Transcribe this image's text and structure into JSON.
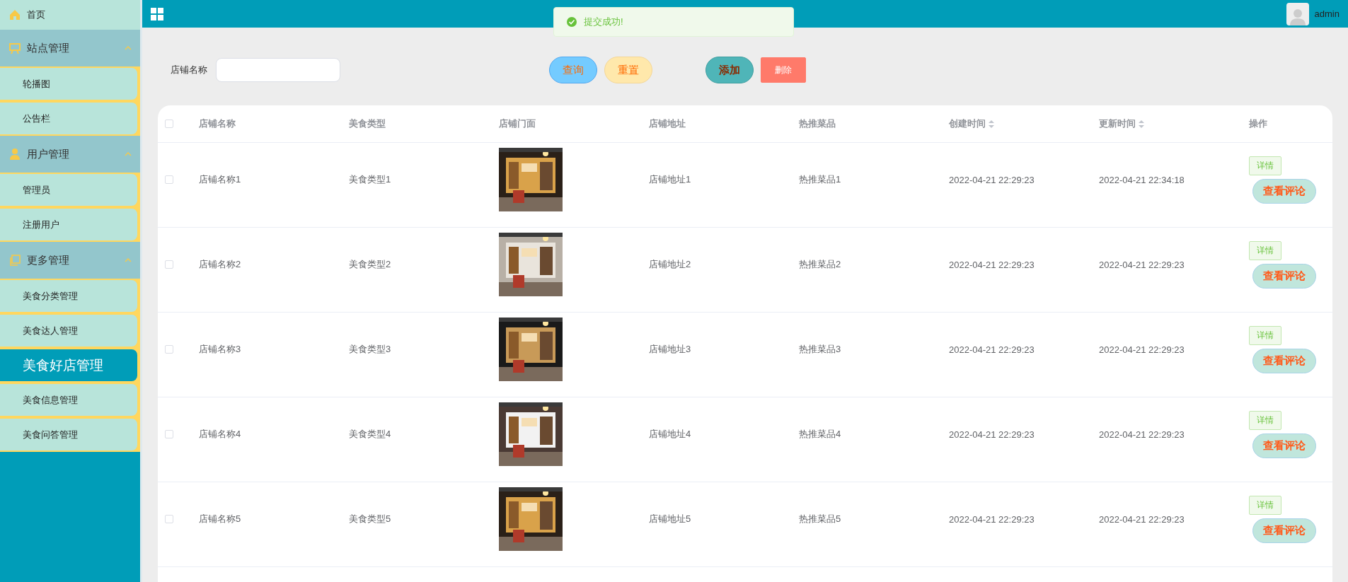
{
  "sidebar": {
    "items": [
      {
        "kind": "link",
        "label": "首页",
        "selected": false
      },
      {
        "kind": "group",
        "label": "站点管理",
        "expanded": true,
        "children": [
          {
            "label": "轮播图",
            "selected": false
          },
          {
            "label": "公告栏",
            "selected": false
          }
        ]
      },
      {
        "kind": "group",
        "label": "用户管理",
        "expanded": true,
        "children": [
          {
            "label": "管理员",
            "selected": false
          },
          {
            "label": "注册用户",
            "selected": false
          }
        ]
      },
      {
        "kind": "group",
        "label": "更多管理",
        "expanded": true,
        "children": [
          {
            "label": "美食分类管理",
            "selected": false
          },
          {
            "label": "美食达人管理",
            "selected": false
          },
          {
            "label": "美食好店管理",
            "selected": true
          },
          {
            "label": "美食信息管理",
            "selected": false
          },
          {
            "label": "美食问答管理",
            "selected": false
          }
        ]
      }
    ]
  },
  "header": {
    "user": "admin"
  },
  "toast": {
    "message": "提交成功!",
    "kind": "success"
  },
  "search": {
    "label": "店铺名称"
  },
  "buttons": [
    {
      "label": "查询",
      "kind": "query"
    },
    {
      "label": "重置",
      "kind": "reset"
    },
    {
      "label": "添加",
      "kind": "add"
    },
    {
      "label": "删除",
      "kind": "delete"
    }
  ],
  "table": {
    "all_checked": false,
    "columns": [
      {
        "label": "店铺名称",
        "sortable": false
      },
      {
        "label": "美食类型",
        "sortable": false
      },
      {
        "label": "店铺门面",
        "sortable": false
      },
      {
        "label": "店铺地址",
        "sortable": false
      },
      {
        "label": "热推菜品",
        "sortable": false
      },
      {
        "label": "创建时间",
        "sortable": true
      },
      {
        "label": "更新时间",
        "sortable": true
      },
      {
        "label": "操作",
        "sortable": false
      }
    ],
    "rows": [
      {
        "checked": false,
        "name": "店铺名称1",
        "type": "美食类型1",
        "address": "店铺地址1",
        "dish": "热推菜品1",
        "created": "2022-04-21 22:29:23",
        "updated": "2022-04-21 22:34:18",
        "detail": "详情",
        "comments": "查看评论"
      },
      {
        "checked": false,
        "name": "店铺名称2",
        "type": "美食类型2",
        "address": "店铺地址2",
        "dish": "热推菜品2",
        "created": "2022-04-21 22:29:23",
        "updated": "2022-04-21 22:29:23",
        "detail": "详情",
        "comments": "查看评论"
      },
      {
        "checked": false,
        "name": "店铺名称3",
        "type": "美食类型3",
        "address": "店铺地址3",
        "dish": "热推菜品3",
        "created": "2022-04-21 22:29:23",
        "updated": "2022-04-21 22:29:23",
        "detail": "详情",
        "comments": "查看评论"
      },
      {
        "checked": false,
        "name": "店铺名称4",
        "type": "美食类型4",
        "address": "店铺地址4",
        "dish": "热推菜品4",
        "created": "2022-04-21 22:29:23",
        "updated": "2022-04-21 22:29:23",
        "detail": "详情",
        "comments": "查看评论"
      },
      {
        "checked": false,
        "name": "店铺名称5",
        "type": "美食类型5",
        "address": "店铺地址5",
        "dish": "热推菜品5",
        "created": "2022-04-21 22:29:23",
        "updated": "2022-04-21 22:29:23",
        "detail": "详情",
        "comments": "查看评论"
      }
    ]
  }
}
